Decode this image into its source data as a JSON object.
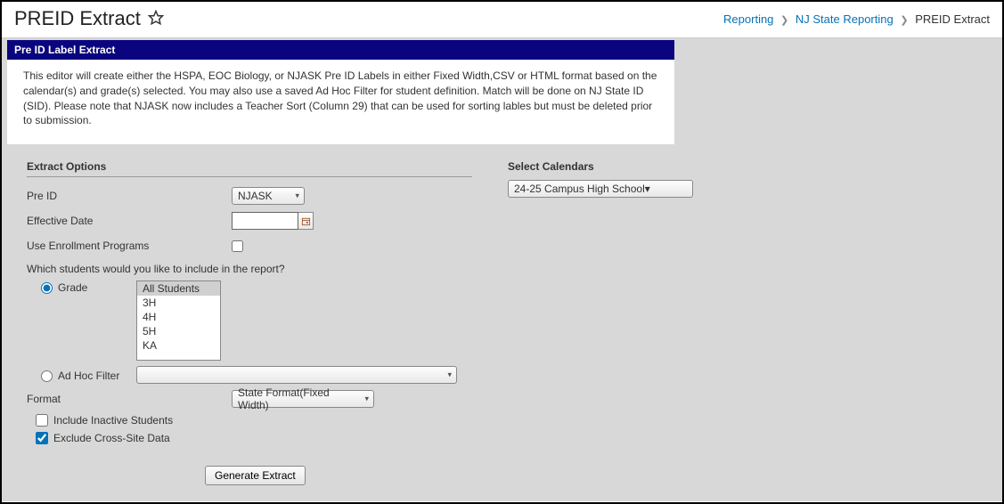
{
  "page": {
    "title": "PREID Extract"
  },
  "breadcrumb": {
    "item1": "Reporting",
    "item2": "NJ State Reporting",
    "current": "PREID Extract"
  },
  "panel": {
    "header": "Pre ID Label Extract",
    "description": "This editor will create either the HSPA, EOC Biology, or NJASK Pre ID Labels in either Fixed Width,CSV or HTML format based on the calendar(s) and grade(s) selected. You may also use a saved Ad Hoc Filter for student definition. Match will be done on NJ State ID (SID). Please note that NJASK now includes a Teacher Sort (Column 29) that can be used for sorting lables but must be deleted prior to submission."
  },
  "left": {
    "section_label": "Extract Options",
    "preid_label": "Pre ID",
    "preid_value": "NJASK",
    "effective_date_label": "Effective Date",
    "effective_date_value": "",
    "use_enroll_label": "Use Enrollment Programs",
    "question": "Which students would you like to include in the report?",
    "grade_label": "Grade",
    "grade_options": [
      "All Students",
      "3H",
      "4H",
      "5H",
      "KA"
    ],
    "adhoc_label": "Ad Hoc Filter",
    "adhoc_value": "",
    "format_label": "Format",
    "format_value": "State Format(Fixed Width)",
    "include_inactive_label": "Include Inactive Students",
    "exclude_crosssite_label": "Exclude Cross-Site Data",
    "generate_btn": "Generate Extract"
  },
  "right": {
    "section_label": "Select Calendars",
    "calendar_value": "24-25 Campus High School"
  }
}
